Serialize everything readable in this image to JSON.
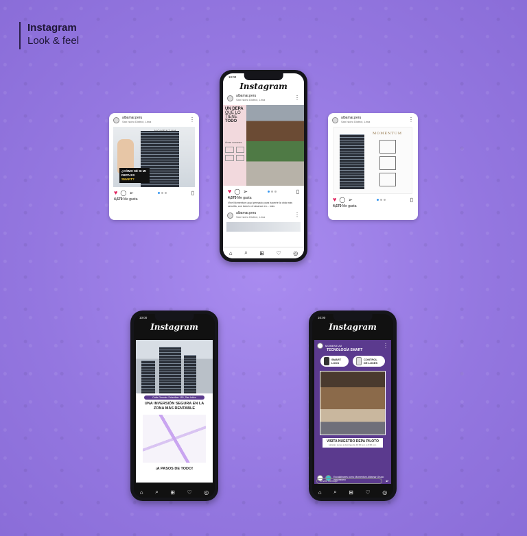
{
  "header": {
    "title": "Instagram",
    "subtitle": "Look & feel"
  },
  "posts": {
    "account": "albamar.peru",
    "location": "San Isidro District, Lima",
    "likes": "4,670",
    "likes_label": "Me gusta",
    "left_post": {
      "brand": "MOMENTUM",
      "question": "¿CÓMO SÉ SI MI DEPA ES",
      "question_highlight": "SMART?"
    },
    "center_post": {
      "time": "10:00",
      "logo": "Instagram",
      "headline_lines": [
        "UN DEPA",
        "QUE LO",
        "TIENE",
        "TODO"
      ],
      "features_title": "Áreas comunes",
      "caption": "Vive Momentum aquí pensado para hacerte la vida más sencilla, con todo lo el alcance en... más"
    },
    "right_post": {
      "brand": "MOMENTUM"
    }
  },
  "phone_bl": {
    "time": "10:00",
    "logo": "Instagram",
    "address": "Calle Germán Schreiber 180, San Isidro",
    "headline": "UNA INVERSIÓN SEGURA EN LA ZONA MÁS RENTABLE",
    "footer": "¡A PASOS DE TODO!"
  },
  "phone_br": {
    "time": "10:00",
    "logo": "Instagram",
    "account": "MOMENTUM",
    "story_title": "TECNOLOGÍA SMART",
    "feature_1": "SMART LOCK",
    "feature_2": "CONTROL DE LUCES",
    "cta": "VISITA NUESTRO DEPA PILOTO",
    "cta_sub": "Horario: Lunes a domingo de 10:00 a.m. a 6:00 p.m.",
    "reply": "Enviar mensaje",
    "caption": "Escalalinares como Momentum Albamar Grupo Inmobiliario"
  },
  "icons": [
    "home-icon",
    "search-icon",
    "add-icon",
    "heart-icon",
    "profile-icon",
    "comment-icon",
    "share-icon",
    "bookmark-icon",
    "more-icon"
  ],
  "colors": {
    "background": "#9b7de6",
    "purple_accent": "#5b3a8e",
    "like_red": "#e0245e",
    "frame": "#15151a"
  }
}
